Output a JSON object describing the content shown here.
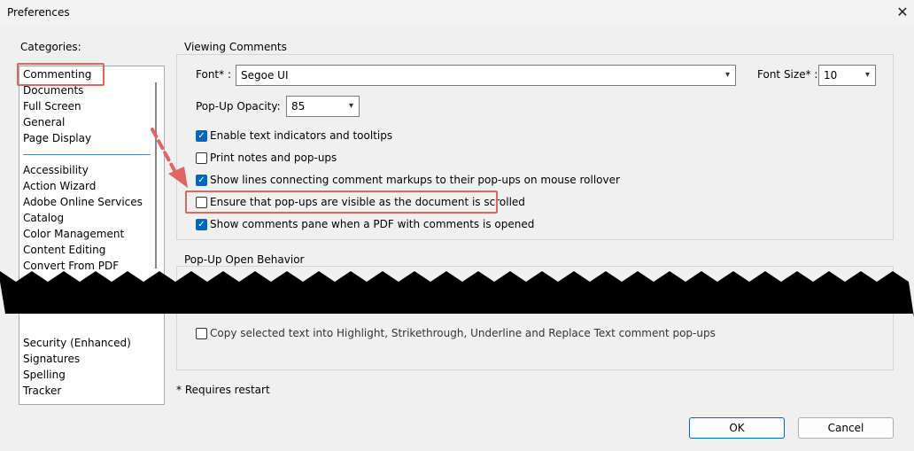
{
  "window": {
    "title": "Preferences",
    "close_glyph": "✕"
  },
  "categories": {
    "label": "Categories:",
    "items": [
      "Commenting",
      "Documents",
      "Full Screen",
      "General",
      "Page Display",
      "Accessibility",
      "Action Wizard",
      "Adobe Online Services",
      "Catalog",
      "Color Management",
      "Content Editing",
      "Convert From PDF",
      "Security (Enhanced)",
      "Signatures",
      "Spelling",
      "Tracker"
    ],
    "selected": "Commenting"
  },
  "viewing": {
    "title": "Viewing Comments",
    "font_label": "Font* :",
    "font_value": "Segoe UI",
    "font_size_label": "Font Size* :",
    "font_size_value": "10",
    "opacity_label": "Pop-Up Opacity:",
    "opacity_value": "85",
    "options": [
      {
        "label": "Enable text indicators and tooltips",
        "checked": true
      },
      {
        "label": "Print notes and pop-ups",
        "checked": false
      },
      {
        "label": "Show lines connecting comment markups to their pop-ups on mouse rollover",
        "checked": true
      },
      {
        "label": "Ensure that pop-ups are visible as the document is scrolled",
        "checked": false
      },
      {
        "label": "Show comments pane when a PDF with comments is opened",
        "checked": true
      }
    ]
  },
  "popup_behavior": {
    "title": "Pop-Up Open Behavior",
    "copy_option": "Copy selected text into Highlight, Strikethrough, Underline and Replace Text comment pop-ups"
  },
  "footer": {
    "requires_restart": "* Requires restart",
    "ok": "OK",
    "cancel": "Cancel"
  },
  "colors": {
    "accent": "#0067c0",
    "annotation": "#e06666",
    "checkbox_check": "✓"
  }
}
